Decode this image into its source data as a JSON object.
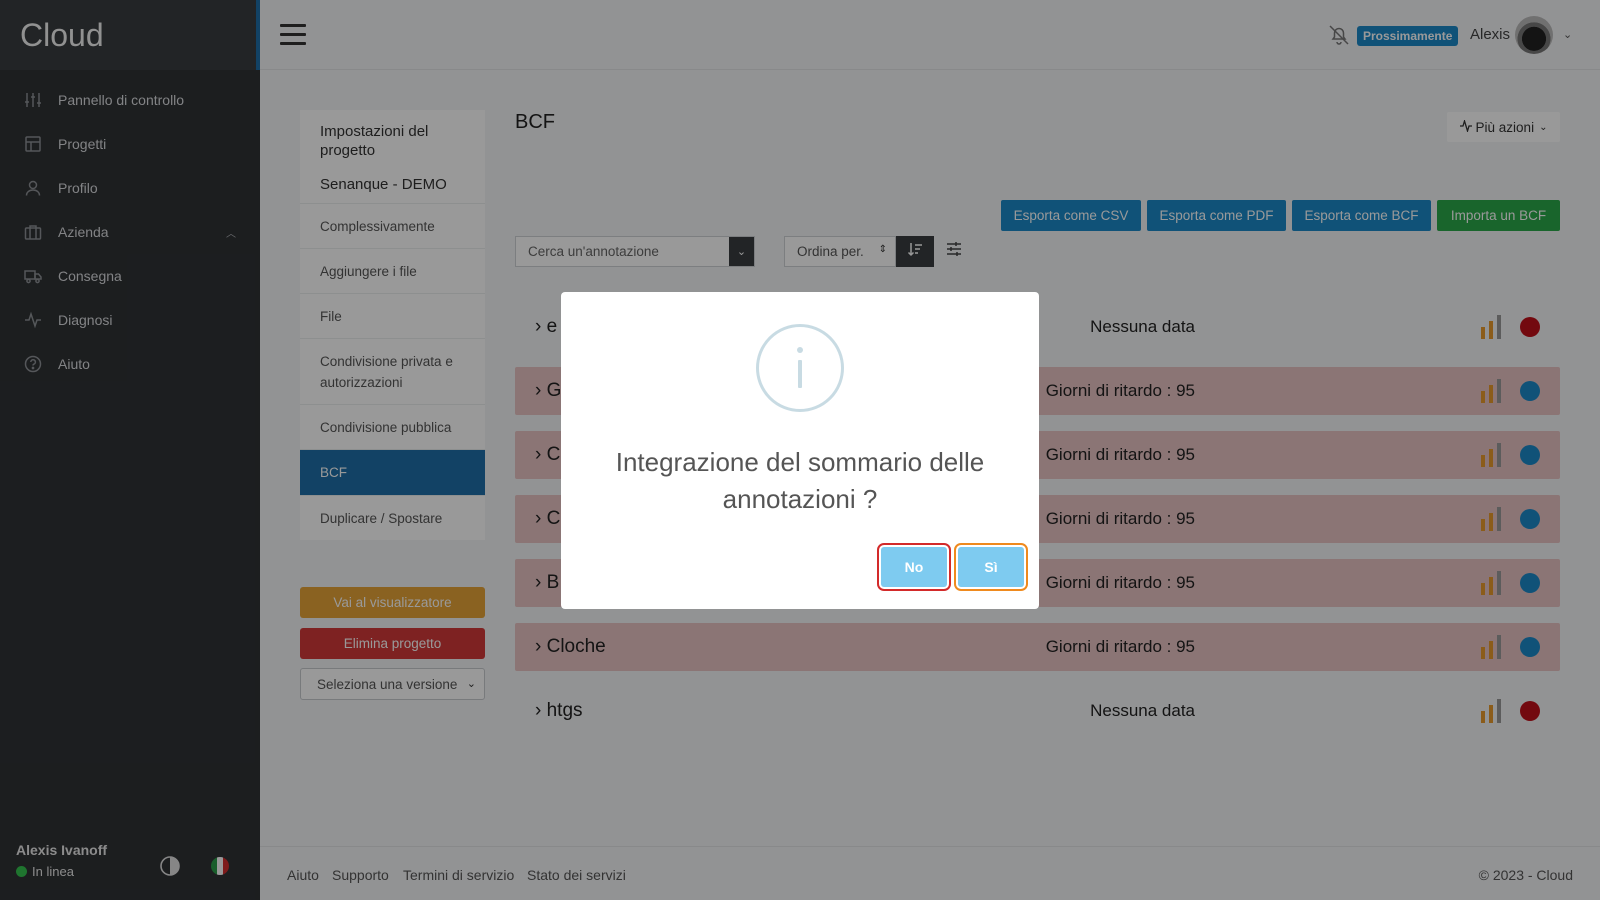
{
  "app": {
    "logo": "Cloud"
  },
  "sidebar": {
    "items": [
      {
        "label": "Pannello di controllo",
        "icon": "sliders-icon"
      },
      {
        "label": "Progetti",
        "icon": "layout-icon"
      },
      {
        "label": "Profilo",
        "icon": "user-icon"
      },
      {
        "label": "Azienda",
        "icon": "briefcase-icon"
      },
      {
        "label": "Consegna",
        "icon": "truck-icon"
      },
      {
        "label": "Diagnosi",
        "icon": "activity-icon"
      },
      {
        "label": "Aiuto",
        "icon": "help-circle-icon"
      }
    ],
    "user": {
      "name": "Alexis Ivanoff",
      "status": "In linea",
      "status_color": "#35c34f"
    }
  },
  "topbar": {
    "badge": "Prossimamente",
    "user": "Alexis"
  },
  "settings": {
    "heading": "Impostazioni del progetto",
    "project": "Senanque - DEMO",
    "items": [
      {
        "label": "Complessivamente"
      },
      {
        "label": "Aggiungere i file"
      },
      {
        "label": "File"
      },
      {
        "label": "Condivisione privata e autorizzazioni"
      },
      {
        "label": "Condivisione pubblica"
      },
      {
        "label": "BCF"
      },
      {
        "label": "Duplicare / Spostare"
      }
    ],
    "viewer_button": "Vai al visualizzatore",
    "delete_button": "Elimina progetto",
    "version_select": "Seleziona una versione"
  },
  "main": {
    "title": "BCF",
    "more_actions": "Più azioni",
    "export_buttons": [
      "Esporta come CSV",
      "Esporta come PDF",
      "Esporta come BCF",
      "Importa un BCF"
    ],
    "search_placeholder": "Cerca un'annotazione",
    "sort_label": "Ordina per.",
    "rows": [
      {
        "name": "e",
        "date": "Nessuna data",
        "status": "ok",
        "dot_color": "#c0101a"
      },
      {
        "name": "G",
        "date": "Giorni di ritardo : 95",
        "status": "late",
        "dot_color": "#1b89c9"
      },
      {
        "name": "C",
        "date": "Giorni di ritardo : 95",
        "status": "late",
        "dot_color": "#1b89c9"
      },
      {
        "name": "C",
        "date": "Giorni di ritardo : 95",
        "status": "late",
        "dot_color": "#1b89c9"
      },
      {
        "name": "B",
        "date": "Giorni di ritardo : 95",
        "status": "late",
        "dot_color": "#1b89c9"
      },
      {
        "name": "Cloche",
        "date": "Giorni di ritardo : 95",
        "status": "late",
        "dot_color": "#1b89c9"
      },
      {
        "name": "htgs",
        "date": "Nessuna data",
        "status": "ok",
        "dot_color": "#c0101a"
      }
    ]
  },
  "footer": {
    "links": [
      "Aiuto",
      "Supporto",
      "Termini di servizio",
      "Stato dei servizi"
    ],
    "copyright": "© 2023 - Cloud"
  },
  "modal": {
    "title": "Integrazione del sommario delle annotazioni ?",
    "no": "No",
    "yes": "Sì"
  },
  "colors": {
    "brand": "#1f6fa8",
    "export": "#1b89c9",
    "import": "#2aa84a",
    "viewer": "#e6a437",
    "delete": "#d33a3a",
    "late_row": "#e8c3c3"
  }
}
